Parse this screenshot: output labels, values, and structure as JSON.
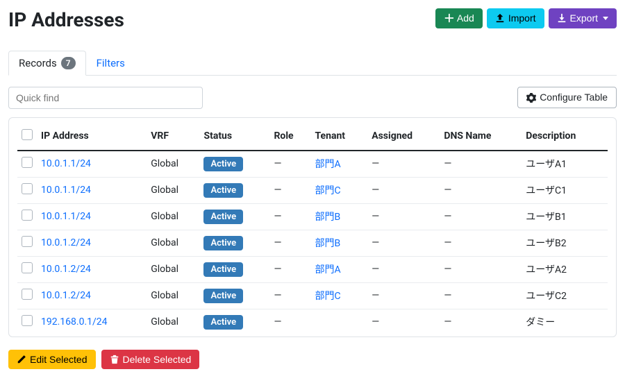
{
  "title": "IP Addresses",
  "header_buttons": {
    "add": "Add",
    "import": "Import",
    "export": "Export"
  },
  "tabs": {
    "records_label": "Records",
    "records_count": "7",
    "filters_label": "Filters"
  },
  "quickfind_placeholder": "Quick find",
  "configure_table_label": "Configure Table",
  "columns": {
    "ip": "IP Address",
    "vrf": "VRF",
    "status": "Status",
    "role": "Role",
    "tenant": "Tenant",
    "assigned": "Assigned",
    "dns": "DNS Name",
    "description": "Description"
  },
  "rows": [
    {
      "ip": "10.0.1.1/24",
      "vrf": "Global",
      "status": "Active",
      "role": "—",
      "tenant": "部門A",
      "assigned": "—",
      "dns": "—",
      "description": "ユーザA1"
    },
    {
      "ip": "10.0.1.1/24",
      "vrf": "Global",
      "status": "Active",
      "role": "—",
      "tenant": "部門C",
      "assigned": "—",
      "dns": "—",
      "description": "ユーザC1"
    },
    {
      "ip": "10.0.1.1/24",
      "vrf": "Global",
      "status": "Active",
      "role": "—",
      "tenant": "部門B",
      "assigned": "—",
      "dns": "—",
      "description": "ユーザB1"
    },
    {
      "ip": "10.0.1.2/24",
      "vrf": "Global",
      "status": "Active",
      "role": "—",
      "tenant": "部門B",
      "assigned": "—",
      "dns": "—",
      "description": "ユーザB2"
    },
    {
      "ip": "10.0.1.2/24",
      "vrf": "Global",
      "status": "Active",
      "role": "—",
      "tenant": "部門A",
      "assigned": "—",
      "dns": "—",
      "description": "ユーザA2"
    },
    {
      "ip": "10.0.1.2/24",
      "vrf": "Global",
      "status": "Active",
      "role": "—",
      "tenant": "部門C",
      "assigned": "—",
      "dns": "—",
      "description": "ユーザC2"
    },
    {
      "ip": "192.168.0.1/24",
      "vrf": "Global",
      "status": "Active",
      "role": "—",
      "tenant": "",
      "assigned": "—",
      "dns": "—",
      "description": "ダミー"
    }
  ],
  "footer": {
    "edit_selected": "Edit Selected",
    "delete_selected": "Delete Selected"
  }
}
